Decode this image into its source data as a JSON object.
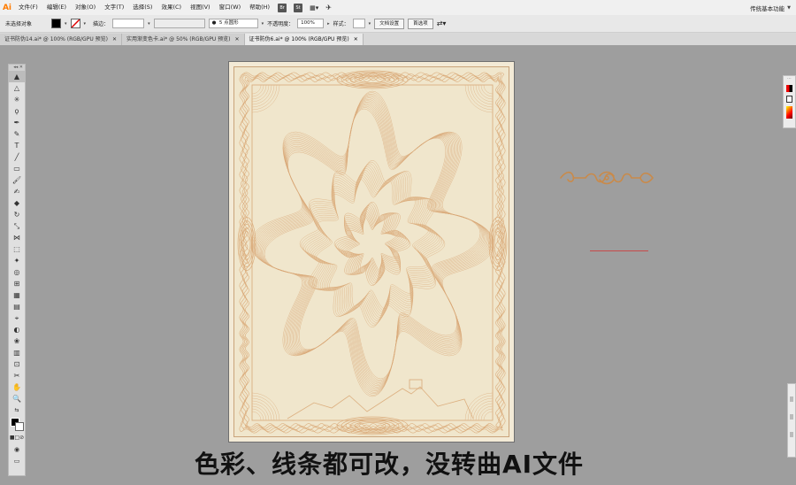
{
  "app": {
    "logo": "Ai"
  },
  "menubar": {
    "items": [
      "文件(F)",
      "编辑(E)",
      "对象(O)",
      "文字(T)",
      "选择(S)",
      "效果(C)",
      "视图(V)",
      "窗口(W)",
      "帮助(H)"
    ],
    "icons": [
      "Br",
      "St"
    ],
    "workspace": "传统基本功能"
  },
  "controlbar": {
    "selection": "未选择对象",
    "stroke_label": "描边：",
    "brush": "5 点圆形",
    "opacity_label": "不透明度：",
    "opacity": "100%",
    "style_label": "样式：",
    "doc_settings": "文档设置",
    "preferences": "首选项"
  },
  "tabs": [
    {
      "label": "证书防伪14.ai* @ 100% (RGB/GPU 预览)",
      "active": false
    },
    {
      "label": "实用渐变色卡.ai* @ 50% (RGB/GPU 预览)",
      "active": false
    },
    {
      "label": "证书防伪6.ai* @ 100% (RGB/GPU 预览)",
      "active": true
    }
  ],
  "tools": [
    "selection-tool",
    "direct-selection-tool",
    "magic-wand-tool",
    "lasso-tool",
    "pen-tool",
    "curvature-tool",
    "type-tool",
    "line-tool",
    "rectangle-tool",
    "paintbrush-tool",
    "shaper-tool",
    "eraser-tool",
    "rotate-tool",
    "scale-tool",
    "width-tool",
    "free-transform-tool",
    "puppet-warp-tool",
    "shape-builder-tool",
    "perspective-tool",
    "mesh-tool",
    "gradient-tool",
    "eyedropper-tool",
    "blend-tool",
    "symbol-sprayer-tool",
    "column-graph-tool",
    "artboard-tool",
    "slice-tool",
    "hand-tool",
    "zoom-tool"
  ],
  "colors": {
    "accent": "#ff7c00",
    "ornament": "#c98a4a",
    "paper": "#f0e6cc",
    "guilloche": "#d9a877"
  },
  "caption": "色彩、线条都可改，没转曲AI文件"
}
